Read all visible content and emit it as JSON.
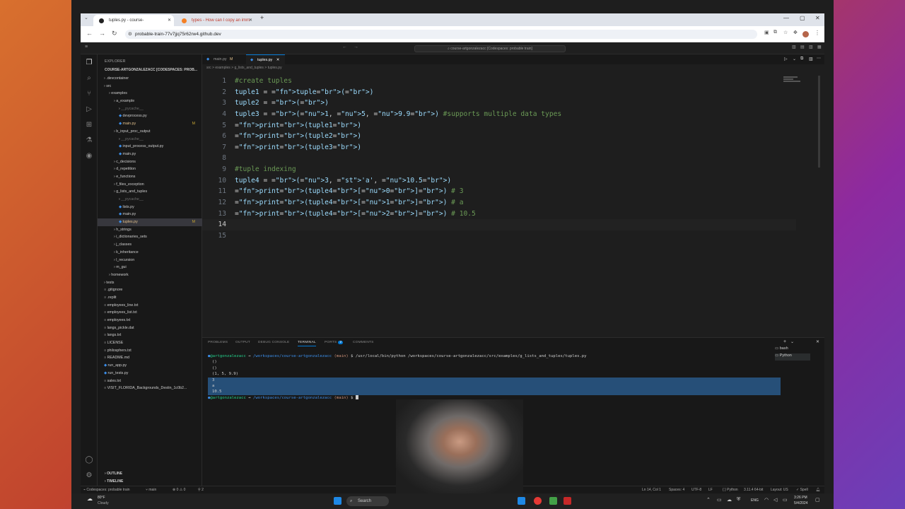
{
  "browser": {
    "tabs": [
      {
        "label": "tuples.py - course-artgonzalezacc",
        "active": true
      },
      {
        "label": "types - How can I copy an imm",
        "active": false
      }
    ],
    "url": "probable-train-77v7jjq75r62rw4.github.dev"
  },
  "vscode": {
    "command_center": "course-artgonzalezacc [Codespaces: probable train]",
    "explorer_title": "EXPLORER",
    "root_folder": "COURSE-ARTGONZALEZACC [CODESPACES: PROB...",
    "tree": [
      {
        "label": ".devcontainer",
        "indent": 1
      },
      {
        "label": "src",
        "indent": 1
      },
      {
        "label": "examples",
        "indent": 2
      },
      {
        "label": "a_example",
        "indent": 3
      },
      {
        "label": "__pycache__",
        "indent": 4
      },
      {
        "label": "devprocess.py",
        "indent": 4
      },
      {
        "label": "main.py",
        "indent": 4,
        "badge": "M"
      },
      {
        "label": "b_input_proc_output",
        "indent": 3
      },
      {
        "label": "__pycache__",
        "indent": 4
      },
      {
        "label": "input_process_output.py",
        "indent": 4
      },
      {
        "label": "main.py",
        "indent": 4
      },
      {
        "label": "c_decisions",
        "indent": 3
      },
      {
        "label": "d_repetition",
        "indent": 3
      },
      {
        "label": "e_functions",
        "indent": 3
      },
      {
        "label": "f_files_exception",
        "indent": 3
      },
      {
        "label": "g_lists_and_tuples",
        "indent": 3
      },
      {
        "label": "__pycache__",
        "indent": 4
      },
      {
        "label": "lists.py",
        "indent": 4
      },
      {
        "label": "main.py",
        "indent": 4
      },
      {
        "label": "tuples.py",
        "indent": 4,
        "badge": "M",
        "selected": true
      },
      {
        "label": "h_strings",
        "indent": 3
      },
      {
        "label": "i_dictionaries_sets",
        "indent": 3
      },
      {
        "label": "j_classes",
        "indent": 3
      },
      {
        "label": "k_inheritance",
        "indent": 3
      },
      {
        "label": "l_recursion",
        "indent": 3
      },
      {
        "label": "m_gui",
        "indent": 3
      },
      {
        "label": "homework",
        "indent": 2
      },
      {
        "label": "tests",
        "indent": 1
      },
      {
        "label": ".gitignore",
        "indent": 1
      },
      {
        "label": ".replit",
        "indent": 1
      },
      {
        "label": "employees_line.txt",
        "indent": 1
      },
      {
        "label": "employees_list.txt",
        "indent": 1
      },
      {
        "label": "employees.txt",
        "indent": 1
      },
      {
        "label": "langs_pickle.dat",
        "indent": 1
      },
      {
        "label": "langs.txt",
        "indent": 1
      },
      {
        "label": "LICENSE",
        "indent": 1
      },
      {
        "label": "philosphers.txt",
        "indent": 1
      },
      {
        "label": "README.md",
        "indent": 1
      },
      {
        "label": "run_app.py",
        "indent": 1
      },
      {
        "label": "run_tests.py",
        "indent": 1
      },
      {
        "label": "sales.txt",
        "indent": 1
      },
      {
        "label": "VISIT_FLORIDA_Backgrounds_Destin_1c0b2...",
        "indent": 1
      }
    ],
    "outline_label": "OUTLINE",
    "timeline_label": "TIMELINE",
    "editor_tabs": [
      {
        "label": "main.py",
        "badge": "M",
        "active": false
      },
      {
        "label": "tuples.py",
        "badge": "",
        "active": true
      }
    ],
    "breadcrumb": "src > examples > g_lists_and_tuples > tuples.py",
    "code_lines": [
      "#create tuples",
      "tuple1 = tuple()",
      "tuple2 = ()",
      "tuple3 = (1, 5, 9.9) #supports multiple data types",
      "print(tuple1)",
      "print(tuple2)",
      "print(tuple3)",
      "",
      "#tuple indexing",
      "tuple4 = (3, 'a', 10.5)",
      "print(tuple4[0]) # 3",
      "print(tuple4[1]) # a",
      "print(tuple4[2]) # 10.5",
      "",
      ""
    ],
    "current_line": 14,
    "panel_tabs": [
      "PROBLEMS",
      "OUTPUT",
      "DEBUG CONSOLE",
      "TERMINAL",
      "PORTS",
      "COMMENTS"
    ],
    "ports_count": "2",
    "terminal": {
      "user": "@artgonzalezacc",
      "path": "/workspaces/course-artgonzalezacc",
      "branch": "(main)",
      "command": "$ /usr/local/bin/python /workspaces/course-artgonzalezacc/src/examples/g_lists_and_tuples/tuples.py",
      "output": [
        "()",
        "()",
        "(1, 5, 9.9)",
        "3",
        "a",
        "10.5"
      ],
      "prompt_end": "$"
    },
    "terminal_list": [
      "bash",
      "Python"
    ],
    "status": {
      "remote": "Codespaces: probable train",
      "branch": "main",
      "problems": "⊗ 0 ⚠ 0",
      "ports": "2",
      "position": "Ln 14, Col 1",
      "spaces": "Spaces: 4",
      "encoding": "UTF-8",
      "eol": "LF",
      "language": "Python",
      "interpreter": "3.11.4 64-bit",
      "layout": "Layout: US",
      "spell": "Spell"
    }
  },
  "taskbar": {
    "weather_temp": "80°F",
    "weather_desc": "Cloudy",
    "search_label": "Search",
    "lang": "ENG",
    "time": "3:26 PM",
    "date": "5/4/2024"
  }
}
